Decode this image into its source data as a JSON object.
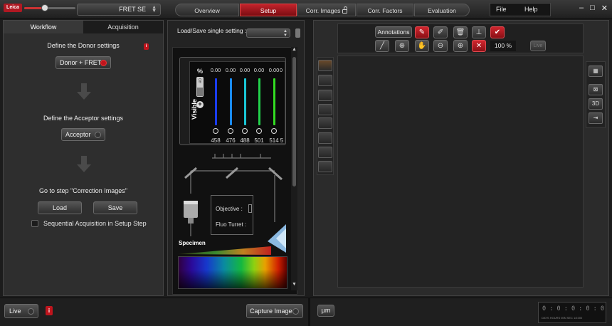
{
  "topbar": {
    "logo": "Leica",
    "mode": "FRET SE",
    "steps": [
      "Overview",
      "Setup",
      "Corr. Images",
      "Corr. Factors",
      "Evaluation"
    ],
    "active_step": "Setup",
    "menu": {
      "file": "File",
      "help": "Help"
    },
    "window_controls": {
      "minimize": "–",
      "maximize": "□",
      "close": "✕"
    }
  },
  "left": {
    "tabs": [
      "Workflow",
      "Acquisition"
    ],
    "active_tab": "Workflow",
    "define_donor": "Define the Donor settings",
    "donor_button": "Donor + FRET",
    "define_acceptor": "Define the Acceptor settings",
    "acceptor_button": "Acceptor",
    "goto_step": "Go to step \"Correction Images\"",
    "load": "Load",
    "save": "Save",
    "sequential": "Sequential Acquisition in Setup Step",
    "info": "i"
  },
  "middle": {
    "load_save_label": "Load/Save single setting :",
    "percent": "%",
    "on_off": "Off",
    "visible_label": "Visible",
    "filters": [
      {
        "value": "0.00",
        "wavelength": "458",
        "color": "#1a3cff"
      },
      {
        "value": "0.00",
        "wavelength": "476",
        "color": "#1a8cff"
      },
      {
        "value": "0.00",
        "wavelength": "488",
        "color": "#19c6d6"
      },
      {
        "value": "0.00",
        "wavelength": "501",
        "color": "#22d04a"
      },
      {
        "value": "0.00",
        "wavelength": "514",
        "color": "#33dd22"
      },
      {
        "value": "0",
        "wavelength": "5",
        "color": "#66ee22"
      }
    ],
    "objective_label": "Objective :",
    "fluo_turret_label": "Fluo Turret :",
    "specimen_label": "Specimen"
  },
  "right": {
    "annotations": "Annotations",
    "zoom": "100 %",
    "live": "Live",
    "side_3d": "3D"
  },
  "bottom": {
    "live": "Live",
    "info": "i",
    "capture": "Capture Image",
    "um": "µm",
    "coords_value": "0 : 0 : 0 : 0 : 0",
    "coords_labels": "DAYS HOURS MIN SEC 1/1000"
  },
  "colors": {
    "accent_red": "#c3232b",
    "panel": "#2e2e2e",
    "background": "#1c1c1c"
  }
}
